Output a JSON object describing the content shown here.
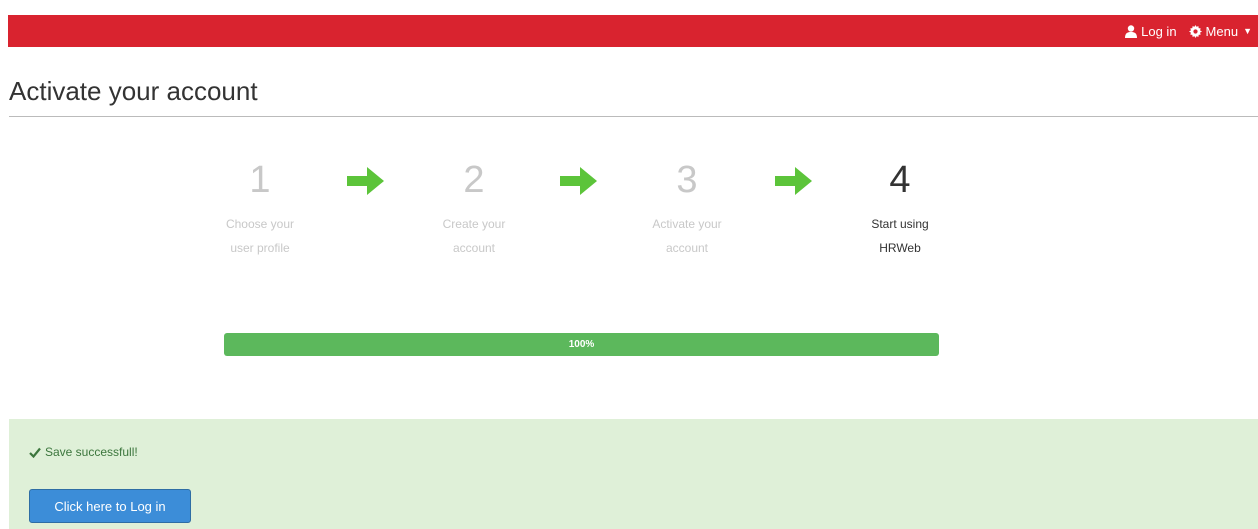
{
  "topbar": {
    "login_label": "Log in",
    "menu_label": "Menu",
    "brand_color": "#d9232f"
  },
  "page_title": "Activate your account",
  "steps": [
    {
      "number": "1",
      "label": "Choose your user profile",
      "state": "inactive"
    },
    {
      "number": "2",
      "label": "Create your account",
      "state": "inactive"
    },
    {
      "number": "3",
      "label": "Activate your account",
      "state": "inactive"
    },
    {
      "number": "4",
      "label": "Start using HRWeb",
      "state": "active"
    }
  ],
  "arrow_color": "#5cc43a",
  "progress": {
    "percent": 100,
    "label": "100%",
    "color": "#5cb85c"
  },
  "alert": {
    "message": "Save successfull!",
    "button_label": "Click here to Log in",
    "background": "#dff0d8"
  },
  "icons": [
    "user-icon",
    "gear-icon",
    "caret-down-icon",
    "arrow-right-icon",
    "checkmark-icon"
  ]
}
